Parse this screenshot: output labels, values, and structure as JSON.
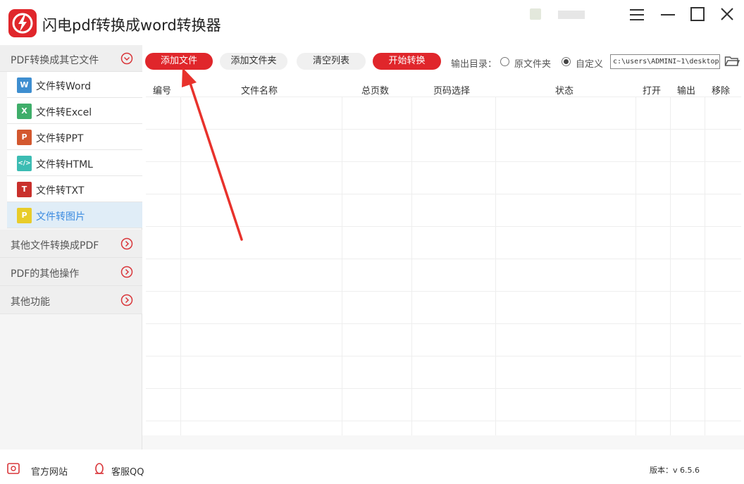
{
  "app": {
    "title": "闪电pdf转换成word转换器",
    "logo_icon": "lightning-logo-icon"
  },
  "window_controls": [
    "menu-icon",
    "minimize-icon",
    "maximize-icon",
    "close-icon"
  ],
  "sidebar": {
    "group_pdf_to_other": "PDF转换成其它文件",
    "items": [
      {
        "label": "文件转Word",
        "icon_letter": "W",
        "color": "#3e8ed0"
      },
      {
        "label": "文件转Excel",
        "icon_letter": "X",
        "color": "#3fae6a"
      },
      {
        "label": "文件转PPT",
        "icon_letter": "P",
        "color": "#d3582f"
      },
      {
        "label": "文件转HTML",
        "icon_letter": "</>",
        "color": "#3cbcb3"
      },
      {
        "label": "文件转TXT",
        "icon_letter": "T",
        "color": "#c9302c"
      },
      {
        "label": "文件转图片",
        "icon_letter": "P",
        "color": "#e8cc2a"
      }
    ],
    "group_other_to_pdf": "其他文件转换成PDF",
    "group_pdf_ops": "PDF的其他操作",
    "group_other_funcs": "其他功能"
  },
  "toolbar": {
    "add_file": "添加文件",
    "add_folder": "添加文件夹",
    "clear_list": "清空列表",
    "start_convert": "开始转换",
    "output_dir_label": "输出目录：",
    "option_original": "原文件夹",
    "option_custom": "自定义",
    "custom_selected": true,
    "path_value": "c:\\users\\ADMINI~1\\desktop"
  },
  "table": {
    "headers": [
      "编号",
      "文件名称",
      "总页数",
      "页码选择",
      "状态",
      "打开",
      "输出",
      "移除"
    ],
    "rows": []
  },
  "footer": {
    "official_site": "官方网站",
    "support_qq": "客服QQ",
    "version": "版本：v 6.5.6"
  },
  "colors": {
    "accent": "#e0262b",
    "active_item_bg": "#e0edf7",
    "active_item_text": "#3b8be0"
  }
}
